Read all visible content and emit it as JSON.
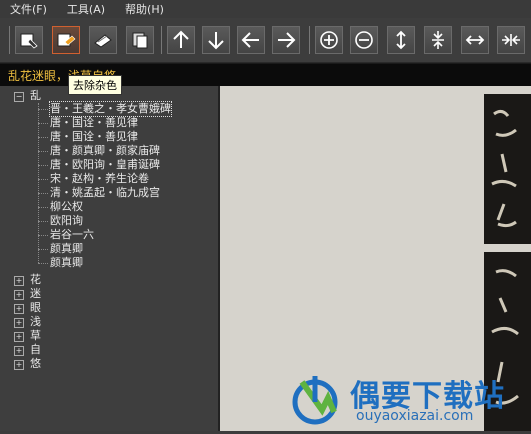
{
  "menu": {
    "items": [
      {
        "label": "文件(F)"
      },
      {
        "label": "工具(A)"
      },
      {
        "label": "帮助(H)"
      }
    ]
  },
  "toolbar": {
    "buttons": [
      {
        "icon": "add-image-icon"
      },
      {
        "icon": "remove-impurity-icon",
        "active": true
      },
      {
        "icon": "eraser-icon"
      },
      {
        "icon": "copy-page-icon"
      },
      {
        "icon": "arrow-up-icon"
      },
      {
        "icon": "arrow-down-icon"
      },
      {
        "icon": "arrow-left-icon"
      },
      {
        "icon": "arrow-right-icon"
      },
      {
        "icon": "zoom-in-icon"
      },
      {
        "icon": "zoom-out-icon"
      },
      {
        "icon": "vertical-expand-icon"
      },
      {
        "icon": "vertical-compress-icon"
      },
      {
        "icon": "horizontal-expand-icon"
      },
      {
        "icon": "horizontal-compress-icon"
      }
    ],
    "tooltip": "去除杂色"
  },
  "text_input": {
    "value": "乱花迷眼，浅草自悠。"
  },
  "tree": {
    "root": {
      "label": "乱",
      "expand_symbol": "−",
      "children": [
        "晋・王羲之・孝女曹娥碑",
        "唐・国诠・善见律",
        "唐・国诠・善见律",
        "唐・颜真卿・颜家庙碑",
        "唐・欧阳询・皇甫诞碑",
        "宋・赵构・养生论卷",
        "清・姚孟起・临九成宫",
        "柳公权",
        "欧阳询",
        "岩谷一六",
        "颜真卿",
        "颜真卿"
      ]
    },
    "collapsed": [
      {
        "label": "花",
        "expand_symbol": "+"
      },
      {
        "label": "迷",
        "expand_symbol": "+"
      },
      {
        "label": "眼",
        "expand_symbol": "+"
      },
      {
        "label": "浅",
        "expand_symbol": "+"
      },
      {
        "label": "草",
        "expand_symbol": "+"
      },
      {
        "label": "自",
        "expand_symbol": "+"
      },
      {
        "label": "悠",
        "expand_symbol": "+"
      }
    ]
  },
  "watermark": {
    "title": "偶要下载站",
    "url": "ouyaoxiazai.com",
    "color": "#1f6fc0"
  },
  "colors": {
    "input_text": "#f0c040",
    "active_border": "#d06030"
  }
}
